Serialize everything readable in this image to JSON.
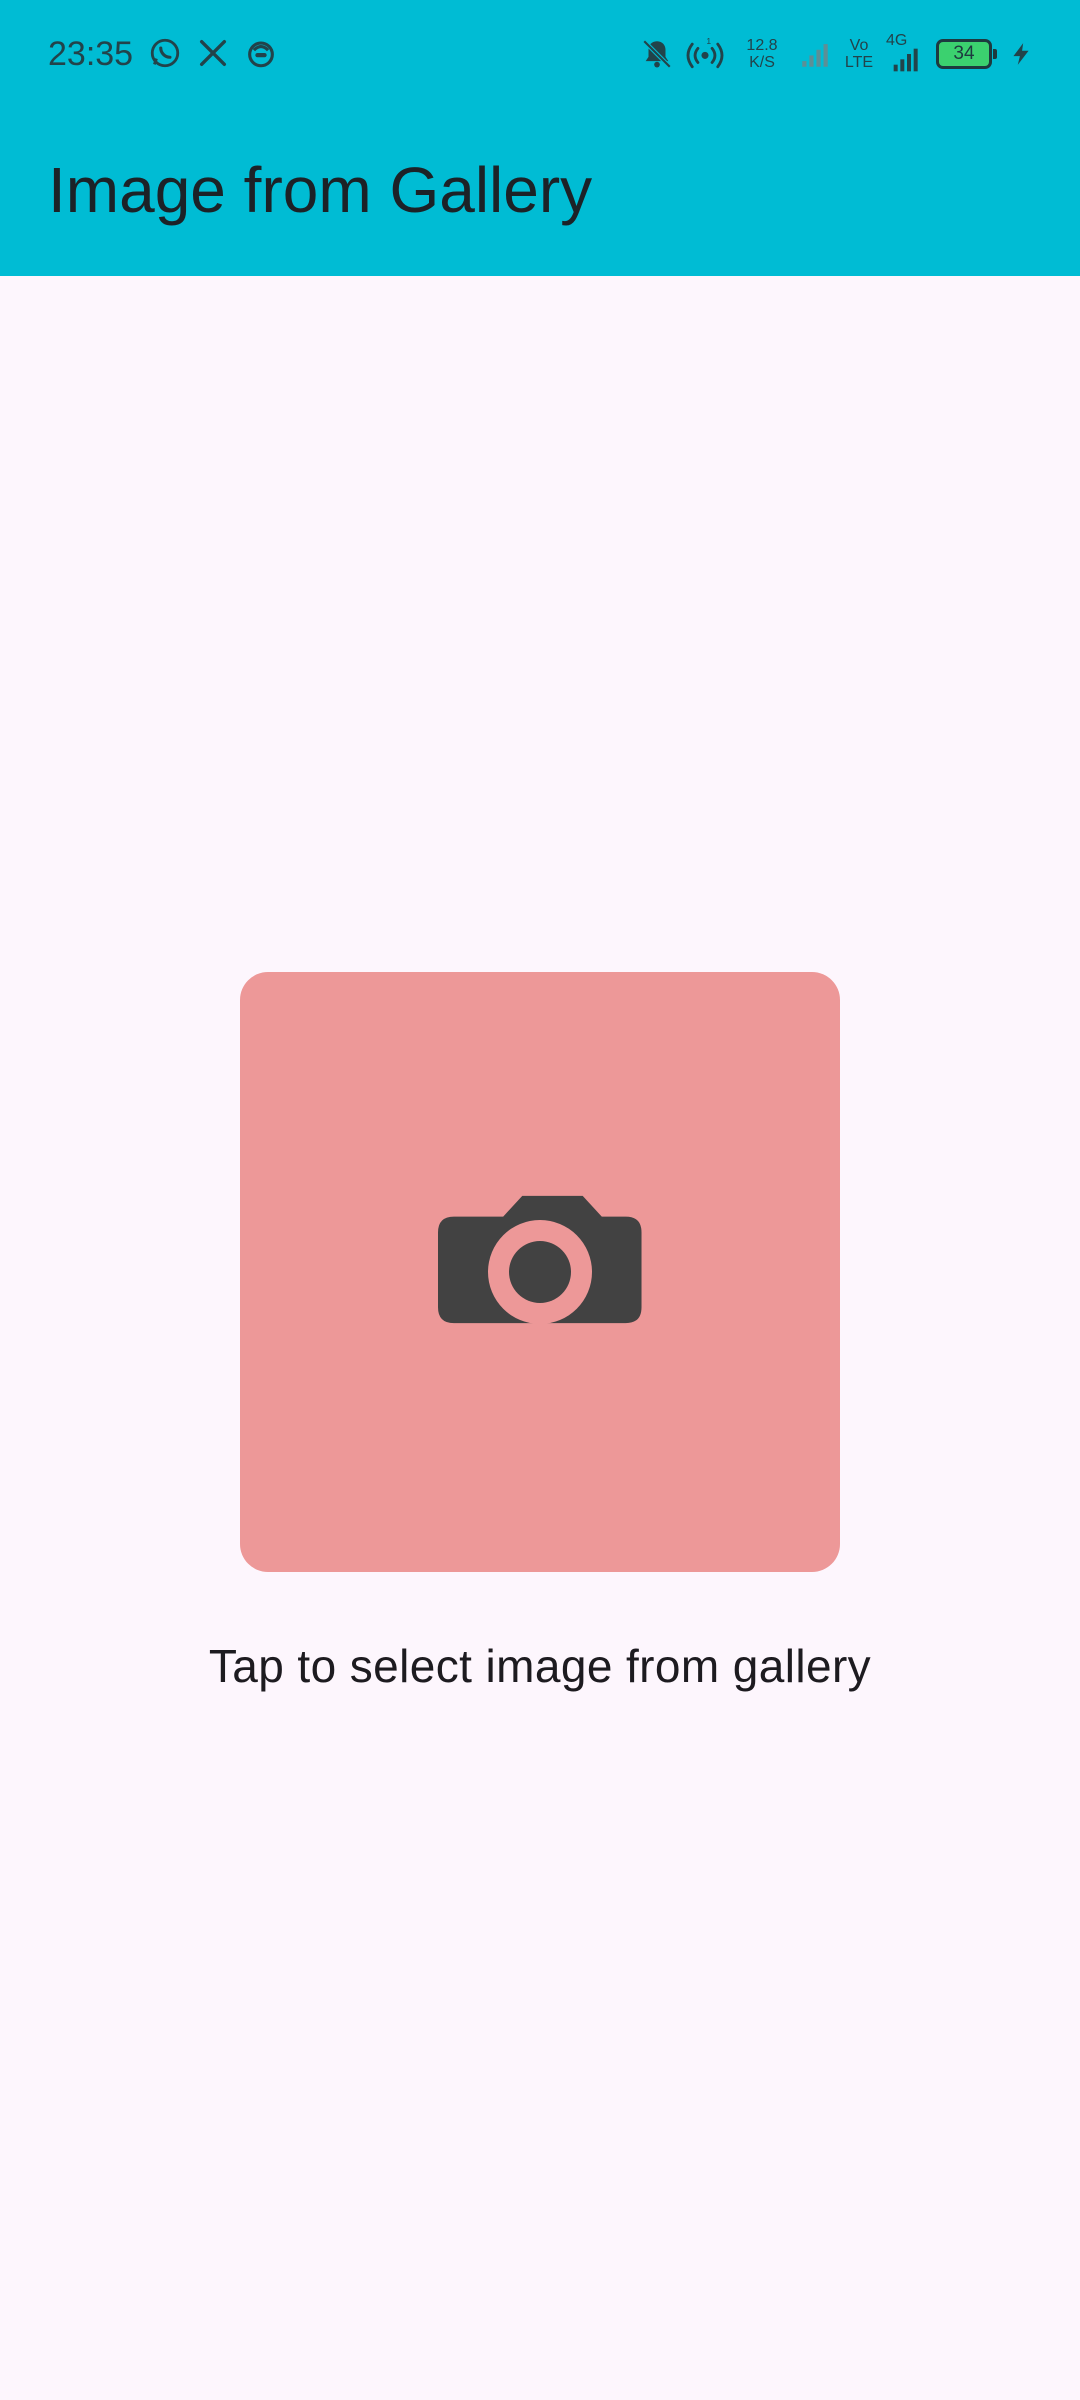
{
  "status_bar": {
    "time": "23:35",
    "left_icons": [
      "whatsapp-icon",
      "x-icon",
      "app-icon"
    ],
    "net_speed_value": "12.8",
    "net_speed_unit": "K/S",
    "volte_top": "Vo",
    "volte_bottom": "LTE",
    "network_type": "4G",
    "battery_level": "34",
    "hotspot_count": "1"
  },
  "app_bar": {
    "title": "Image from Gallery",
    "background_color": "#00bcd4"
  },
  "main": {
    "picker": {
      "icon": "camera-icon",
      "background_color": "#ed9898"
    },
    "caption": "Tap to select image from gallery"
  }
}
